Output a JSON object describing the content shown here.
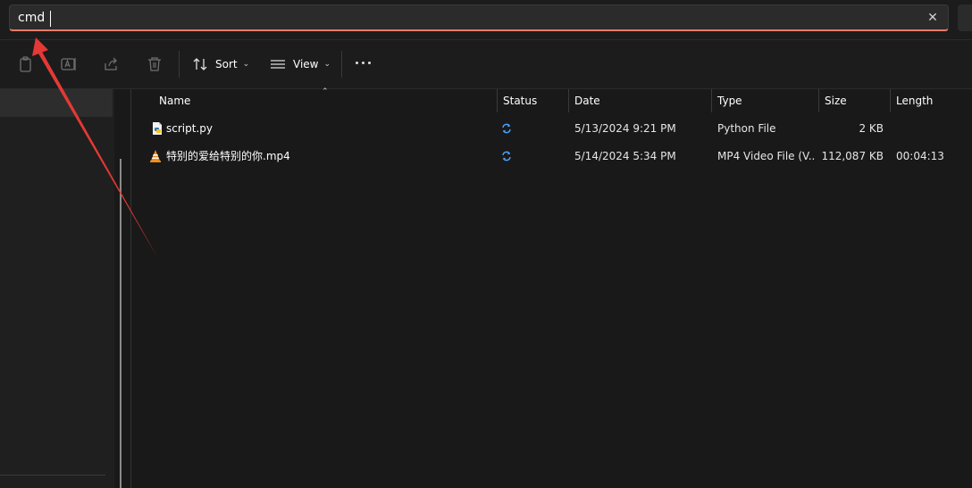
{
  "address_bar": {
    "value": "cmd"
  },
  "toolbar": {
    "sort_label": "Sort",
    "view_label": "View"
  },
  "columns": [
    "Name",
    "Status",
    "Date",
    "Type",
    "Size",
    "Length"
  ],
  "files": [
    {
      "name": "script.py",
      "icon": "python-file-icon",
      "status_icon": "sync-icon",
      "date": "5/13/2024 9:21 PM",
      "type": "Python File",
      "size": "2 KB",
      "length": ""
    },
    {
      "name": "特别的爱给特别的你.mp4",
      "icon": "vlc-cone-icon",
      "status_icon": "sync-icon",
      "date": "5/14/2024 5:34 PM",
      "type": "MP4 Video File (V...",
      "size": "112,087 KB",
      "length": "00:04:13"
    }
  ],
  "colors": {
    "accent_underline": "#e87c6a",
    "sync_blue": "#4aa3ff",
    "annotation_arrow": "#e53935",
    "background": "#191919"
  }
}
